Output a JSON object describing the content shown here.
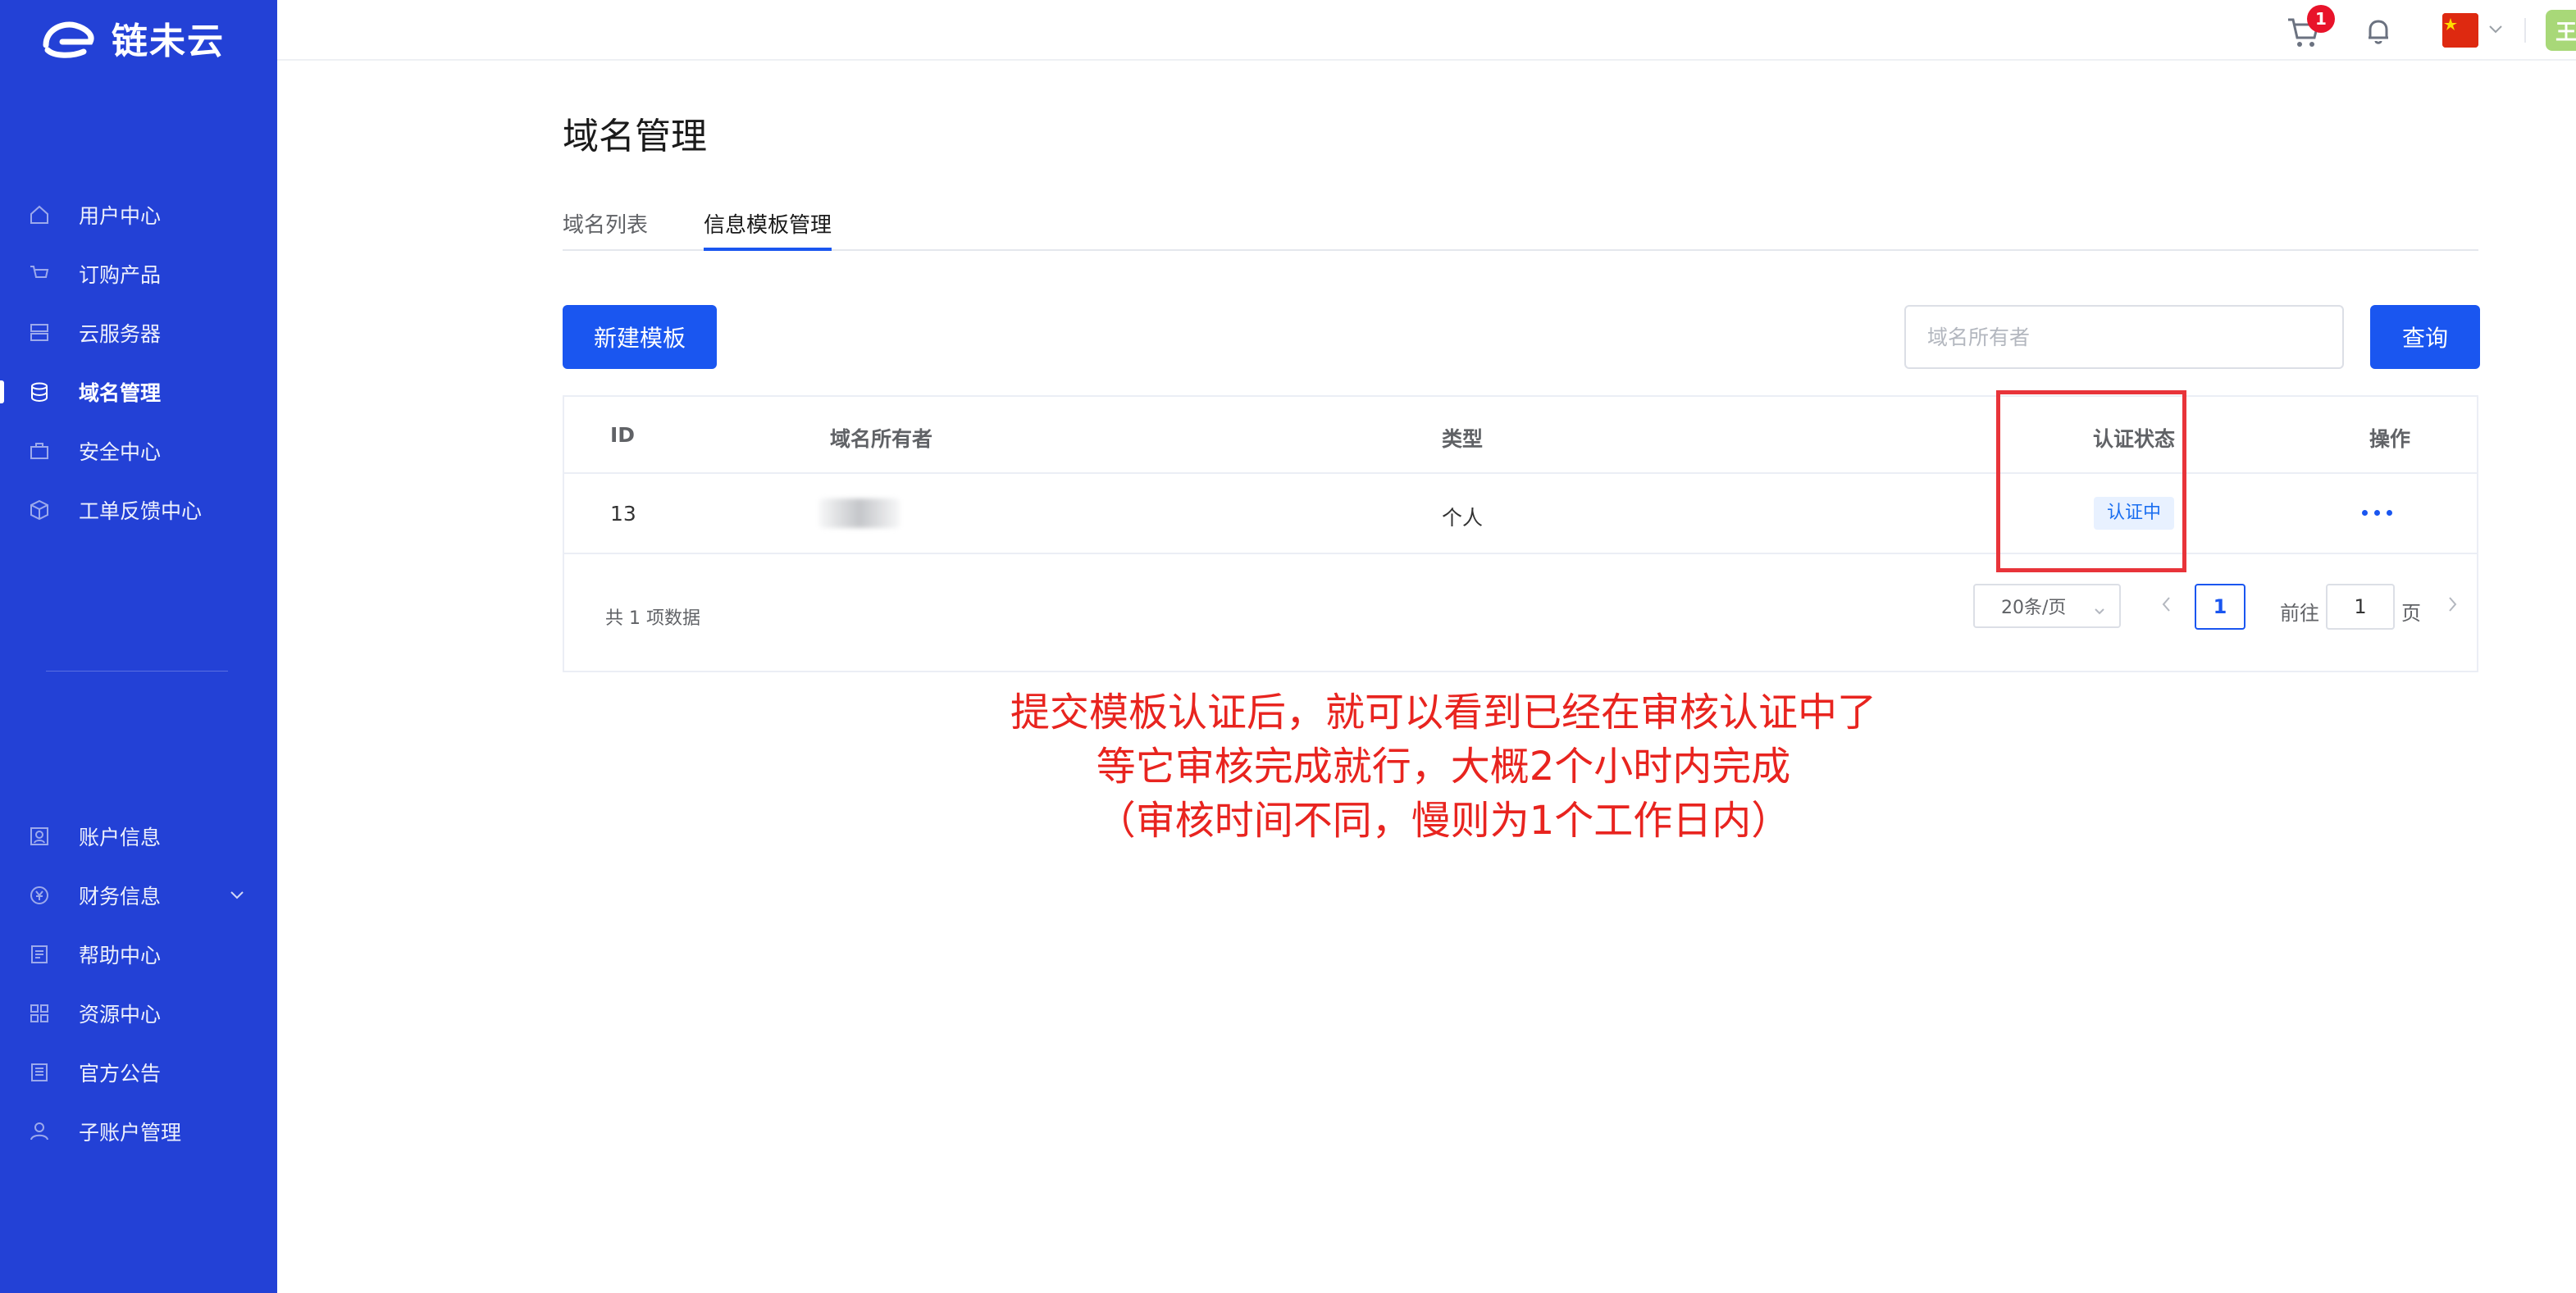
{
  "brand": {
    "name": "链未云"
  },
  "sidebar": {
    "top_items": [
      {
        "label": "用户中心",
        "icon": "home-icon"
      },
      {
        "label": "订购产品",
        "icon": "cart-icon"
      },
      {
        "label": "云服务器",
        "icon": "server-icon"
      },
      {
        "label": "域名管理",
        "icon": "database-icon",
        "active": true
      },
      {
        "label": "安全中心",
        "icon": "briefcase-icon"
      },
      {
        "label": "工单反馈中心",
        "icon": "cube-icon"
      }
    ],
    "bottom_items": [
      {
        "label": "账户信息",
        "icon": "user-card-icon"
      },
      {
        "label": "财务信息",
        "icon": "currency-icon"
      },
      {
        "label": "帮助中心",
        "icon": "document-icon"
      },
      {
        "label": "资源中心",
        "icon": "grid-icon"
      },
      {
        "label": "官方公告",
        "icon": "notice-icon"
      },
      {
        "label": "子账户管理",
        "icon": "sub-account-icon"
      }
    ]
  },
  "topbar": {
    "cart_count": "1",
    "avatar_text": "王"
  },
  "page": {
    "title": "域名管理",
    "tabs": [
      "域名列表",
      "信息模板管理"
    ],
    "new_button": "新建模板",
    "search_placeholder": "域名所有者",
    "query_button": "查询"
  },
  "table": {
    "headers": {
      "id": "ID",
      "owner": "域名所有者",
      "type": "类型",
      "status": "认证状态",
      "op": "操作"
    },
    "rows": [
      {
        "id": "13",
        "owner": "",
        "type": "个人",
        "status": "认证中"
      }
    ]
  },
  "pagination": {
    "total": "共 1 项数据",
    "page_size": "20条/页",
    "current_page": "1",
    "goto_label": "前往",
    "goto_value": "1",
    "page_unit": "页"
  },
  "annotation": {
    "line1": "提交模板认证后，就可以看到已经在审核认证中了",
    "line2": "等它审核完成就行，大概2个小时内完成",
    "line3": "（审核时间不同，慢则为1个工作日内）"
  },
  "colors": {
    "sidebar_bg": "#2341d6",
    "primary": "#1a56f0",
    "annotation_red": "#e8241f",
    "badge_red": "#e8132a"
  }
}
